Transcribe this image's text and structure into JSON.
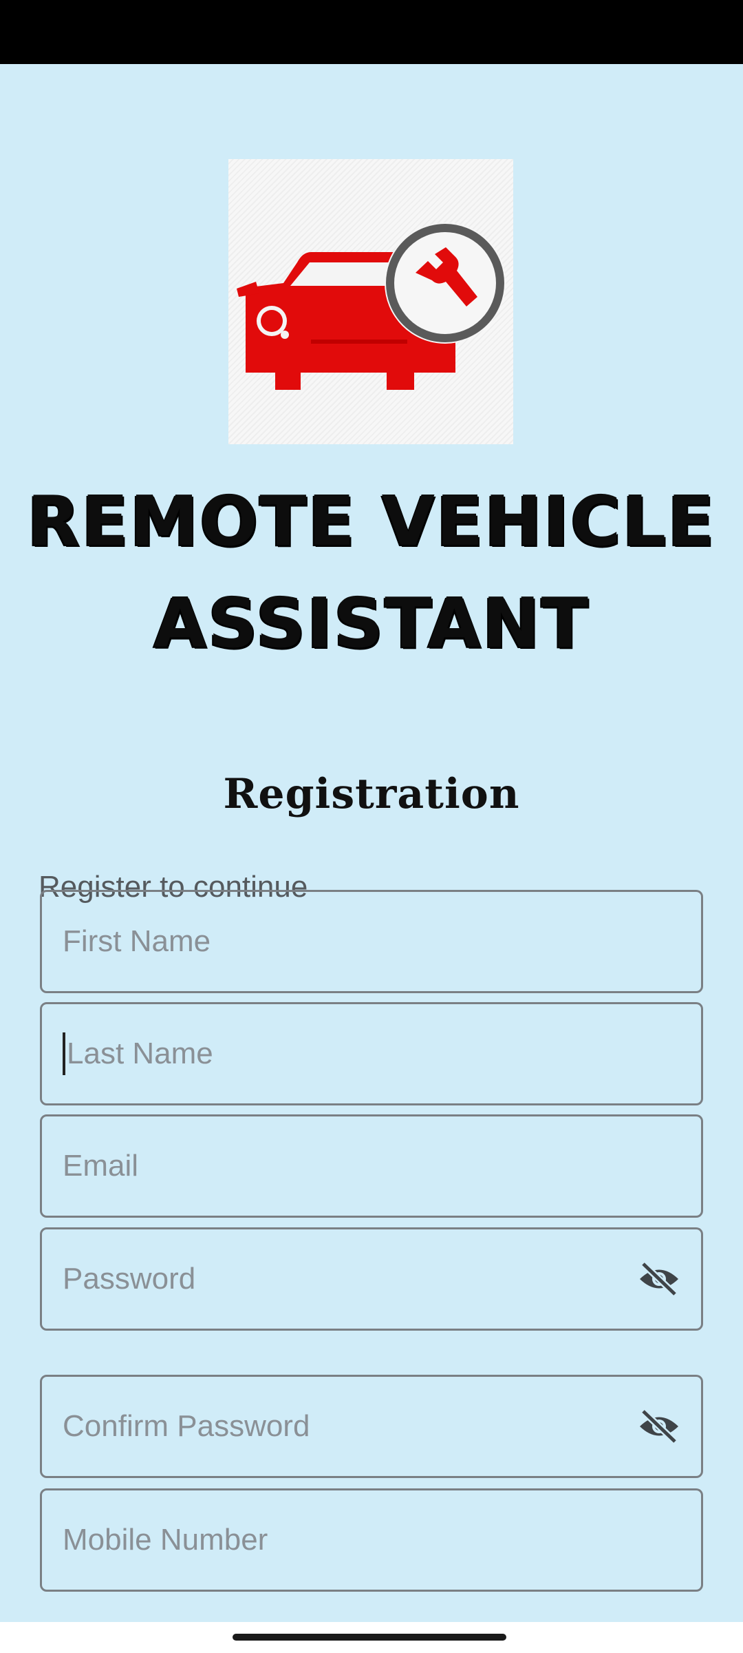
{
  "app": {
    "title_line1": "REMOTE VEHICLE",
    "title_line2": "ASSISTANT",
    "logo_icon": "car-repair-wrench-icon"
  },
  "page": {
    "heading": "Registration",
    "subtitle": "Register to continue"
  },
  "form": {
    "first_name": {
      "placeholder": "First Name",
      "value": ""
    },
    "last_name": {
      "placeholder": "Last Name",
      "value": "",
      "focused": true
    },
    "email": {
      "placeholder": "Email",
      "value": ""
    },
    "password": {
      "placeholder": "Password",
      "value": "",
      "toggle_icon": "eye-off-icon"
    },
    "confirm_password": {
      "placeholder": "Confirm Password",
      "value": "",
      "toggle_icon": "eye-off-icon"
    },
    "mobile": {
      "placeholder": "Mobile Number",
      "value": ""
    }
  },
  "colors": {
    "background": "#d0ecf8",
    "logo_red": "#e10b0b",
    "field_border": "#7a7f84",
    "placeholder": "#8a9096"
  }
}
